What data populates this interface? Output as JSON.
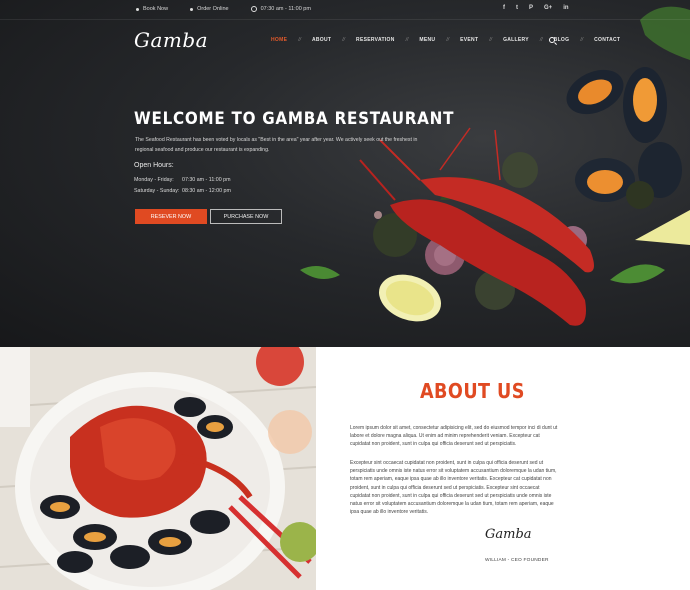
{
  "topbar": {
    "book_now": "Book Now",
    "order_online": "Order Online",
    "hours": "07:30 am - 11:00 pm",
    "social": [
      "f",
      "t",
      "P",
      "G+",
      "in"
    ]
  },
  "logo": "Gamba",
  "nav": {
    "items": [
      "HOME",
      "ABOUT",
      "RESERVATION",
      "MENU",
      "EVENT",
      "GALLERY",
      "BLOG",
      "CONTACT"
    ],
    "separator": "//"
  },
  "hero": {
    "title": "WELCOME TO GAMBA RESTAURANT",
    "description": "The Seafood Restaurant has been voted by locals as \"Best in the area\" year after year. We actively seek out the freshest in regional seafood and produce our restaurant is expanding.",
    "hours_title": "Open Hours:",
    "hours": [
      {
        "days": "Monday - Friday:",
        "time": "07:30 am - 11:00 pm"
      },
      {
        "days": "Saturday - Sunday:",
        "time": "08:30 am - 12:00 pm"
      }
    ],
    "reserve_label": "RESEVER NOW",
    "purchase_label": "PURCHASE NOW"
  },
  "about": {
    "title": "ABOUT US",
    "paragraph1": "Lorem ipsum dolor sit amet, consectetur adipisicing elit, sed do eiusmod tempor inci di dunt ut labore et dolore magna aliqua. Ut enim ad minim reprehenderit veniam. Excepteur cat cupidatat non proident, sunt in culpa qui officia deserunt sed ut perspiciatis.",
    "paragraph2": "Excepteur sint occaecat cupidatat non proident, sunt in culpa qui officia deserunt sed ut perspiciatis unde omnis iste natus error sit voluptatem accusantium doloremque la udan tium, totam rem aperiam, eaque ipsa quae ab illo inventore veritatis. Excepteur cat cupidatat non proident, sunt in culpa qui officia deserunt sed ut perspiciatis. Excepteur sint occaecat cupidatat non proident, sunt in culpa qui officia deserunt sed ut perspiciatis unde omnis iste natus error sit voluptatem accusantium doloremque la udan tium, totam rem aperiam, eaque ipsa quae ab illo inventore veritatis.",
    "signature": "Gamba",
    "signature_caption": "WILLIAM - CEO FOUNDER"
  },
  "colors": {
    "accent": "#e04a22",
    "dark_bg": "#26282b"
  }
}
